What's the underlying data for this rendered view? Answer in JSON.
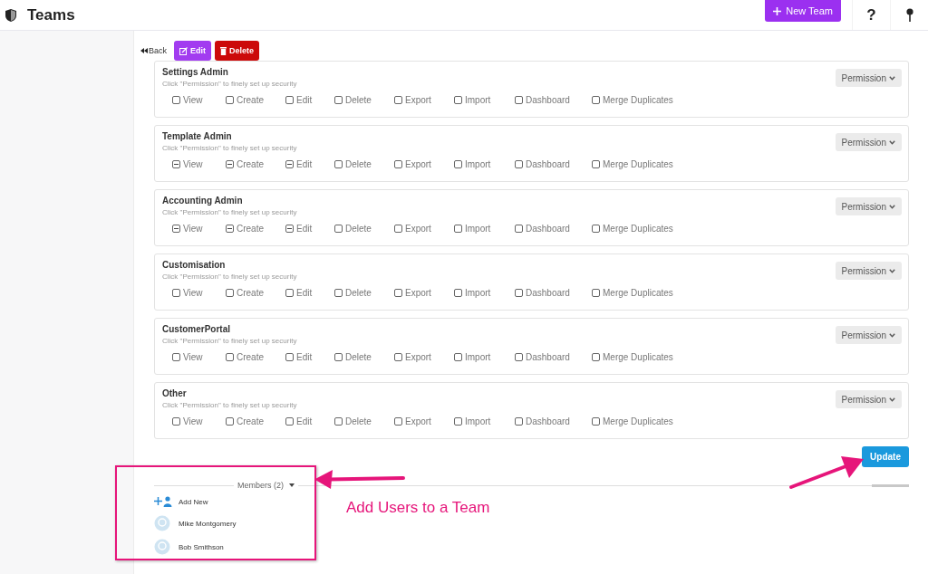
{
  "header": {
    "title": "Teams",
    "new_team_button": "New Team",
    "help_button": "?"
  },
  "toolbar": {
    "back": "Back",
    "edit": "Edit",
    "delete": "Delete"
  },
  "roles": [
    {
      "name": "Settings Admin",
      "hint": "Click \"Permission\" to finely set up security",
      "menu": "Permission",
      "permissions": [
        {
          "label": "View",
          "partial": false
        },
        {
          "label": "Create",
          "partial": false
        },
        {
          "label": "Edit",
          "partial": false
        },
        {
          "label": "Delete",
          "partial": false
        },
        {
          "label": "Export",
          "partial": false
        },
        {
          "label": "Import",
          "partial": false
        },
        {
          "label": "Dashboard",
          "partial": false
        },
        {
          "label": "Merge Duplicates",
          "partial": false
        }
      ]
    },
    {
      "name": "Template Admin",
      "hint": "Click \"Permission\" to finely set up security",
      "menu": "Permission",
      "permissions": [
        {
          "label": "View",
          "partial": true
        },
        {
          "label": "Create",
          "partial": true
        },
        {
          "label": "Edit",
          "partial": true
        },
        {
          "label": "Delete",
          "partial": false
        },
        {
          "label": "Export",
          "partial": false
        },
        {
          "label": "Import",
          "partial": false
        },
        {
          "label": "Dashboard",
          "partial": false
        },
        {
          "label": "Merge Duplicates",
          "partial": false
        }
      ]
    },
    {
      "name": "Accounting Admin",
      "hint": "Click \"Permission\" to finely set up security",
      "menu": "Permission",
      "permissions": [
        {
          "label": "View",
          "partial": true
        },
        {
          "label": "Create",
          "partial": true
        },
        {
          "label": "Edit",
          "partial": true
        },
        {
          "label": "Delete",
          "partial": false
        },
        {
          "label": "Export",
          "partial": false
        },
        {
          "label": "Import",
          "partial": false
        },
        {
          "label": "Dashboard",
          "partial": false
        },
        {
          "label": "Merge Duplicates",
          "partial": false
        }
      ]
    },
    {
      "name": "Customisation",
      "hint": "Click \"Permission\" to finely set up security",
      "menu": "Permission",
      "permissions": [
        {
          "label": "View",
          "partial": false
        },
        {
          "label": "Create",
          "partial": false
        },
        {
          "label": "Edit",
          "partial": false
        },
        {
          "label": "Delete",
          "partial": false
        },
        {
          "label": "Export",
          "partial": false
        },
        {
          "label": "Import",
          "partial": false
        },
        {
          "label": "Dashboard",
          "partial": false
        },
        {
          "label": "Merge Duplicates",
          "partial": false
        }
      ]
    },
    {
      "name": "CustomerPortal",
      "hint": "Click \"Permission\" to finely set up security",
      "menu": "Permission",
      "permissions": [
        {
          "label": "View",
          "partial": false
        },
        {
          "label": "Create",
          "partial": false
        },
        {
          "label": "Edit",
          "partial": false
        },
        {
          "label": "Delete",
          "partial": false
        },
        {
          "label": "Export",
          "partial": false
        },
        {
          "label": "Import",
          "partial": false
        },
        {
          "label": "Dashboard",
          "partial": false
        },
        {
          "label": "Merge Duplicates",
          "partial": false
        }
      ]
    },
    {
      "name": "Other",
      "hint": "Click \"Permission\" to finely set up security",
      "menu": "Permission",
      "permissions": [
        {
          "label": "View",
          "partial": false
        },
        {
          "label": "Create",
          "partial": false
        },
        {
          "label": "Edit",
          "partial": false
        },
        {
          "label": "Delete",
          "partial": false
        },
        {
          "label": "Export",
          "partial": false
        },
        {
          "label": "Import",
          "partial": false
        },
        {
          "label": "Dashboard",
          "partial": false
        },
        {
          "label": "Merge Duplicates",
          "partial": false
        }
      ]
    }
  ],
  "update_button": "Update",
  "members": {
    "title": "Members (2)",
    "add_new": "Add New",
    "people": [
      {
        "name": "Mike Montgomery"
      },
      {
        "name": "Bob Smithson"
      }
    ]
  },
  "annotation": {
    "text": "Add Users to a Team"
  }
}
